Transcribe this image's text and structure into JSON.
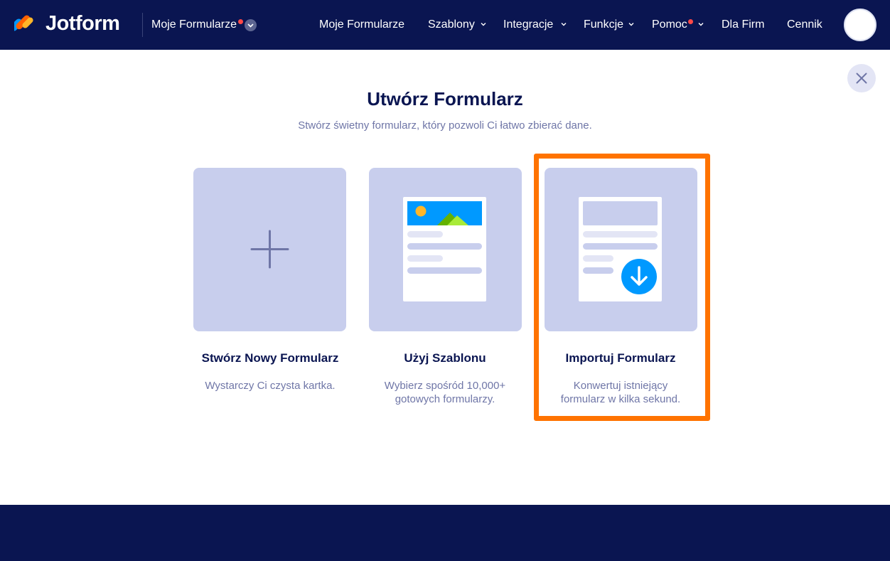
{
  "header": {
    "brand": "Jotform",
    "my_forms_dropdown": "Moje Formularze",
    "nav": {
      "my_forms": "Moje Formularze",
      "templates": "Szablony",
      "integrations": "Integracje",
      "features": "Funkcje",
      "help": "Pomoc",
      "enterprise": "Dla Firm",
      "pricing": "Cennik"
    }
  },
  "modal": {
    "title": "Utwórz Formularz",
    "subtitle": "Stwórz świetny formularz, który pozwoli Ci łatwo zbierać dane.",
    "cards": [
      {
        "title": "Stwórz Nowy Formularz",
        "desc": "Wystarczy Ci czysta kartka.",
        "icon": "plus-icon"
      },
      {
        "title": "Użyj Szablonu",
        "desc_line1": "Wybierz spośród 10,000+",
        "desc_line2": "gotowych formularzy.",
        "icon": "template-document-icon"
      },
      {
        "title": "Importuj Formularz",
        "desc_line1": "Konwertuj istniejący",
        "desc_line2": "formularz w kilka sekund.",
        "icon": "import-document-icon"
      }
    ]
  },
  "colors": {
    "navy": "#0a1551",
    "tile": "#c8ceed",
    "highlight": "#ff7300",
    "accent_blue": "#0099ff",
    "notification": "#ff4948"
  }
}
